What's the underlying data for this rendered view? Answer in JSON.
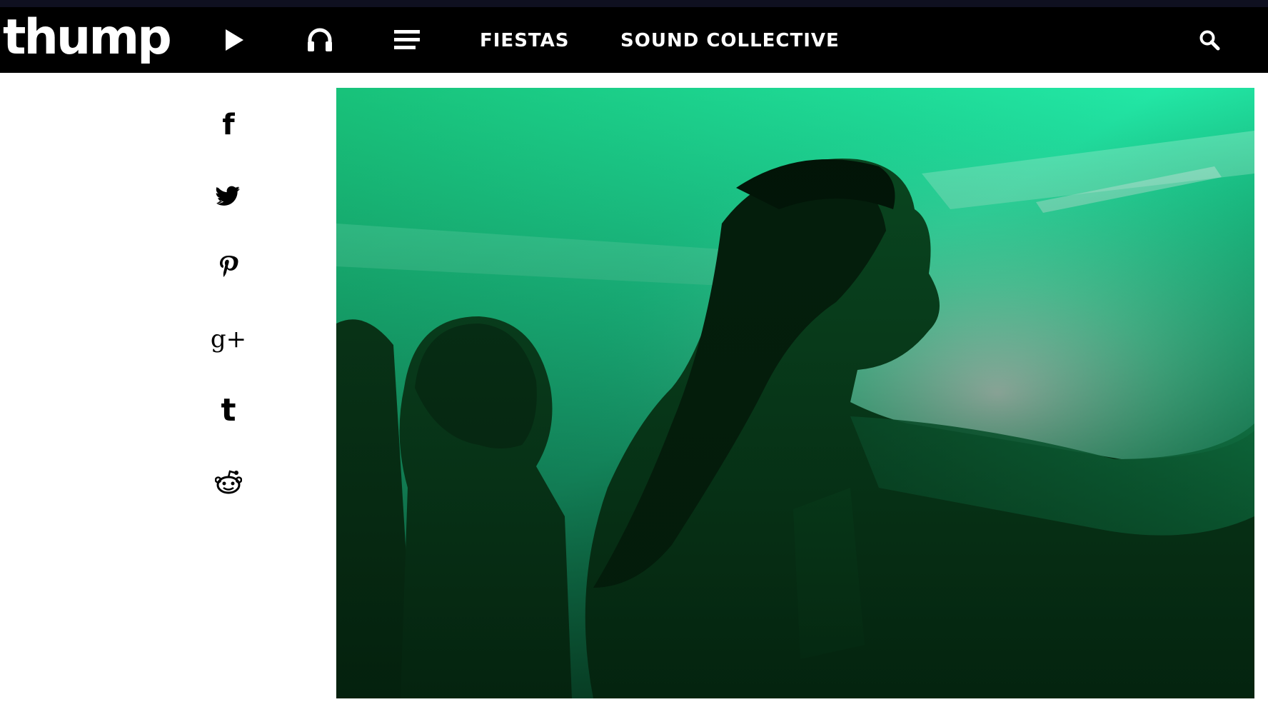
{
  "header": {
    "logo_text": "thump",
    "nav_icons": [
      {
        "icon": "play-icon"
      },
      {
        "icon": "headphones-icon"
      },
      {
        "icon": "menu-icon"
      }
    ],
    "nav_links": [
      {
        "label": "FIESTAS"
      },
      {
        "label": "SOUND COLLECTIVE"
      }
    ],
    "search_icon": "search-icon"
  },
  "share": {
    "buttons": [
      {
        "network": "facebook",
        "icon": "facebook-icon",
        "glyph": "f"
      },
      {
        "network": "twitter",
        "icon": "twitter-icon"
      },
      {
        "network": "pinterest",
        "icon": "pinterest-icon",
        "glyph": "P"
      },
      {
        "network": "google-plus",
        "icon": "google-plus-icon",
        "glyph": "g+"
      },
      {
        "network": "tumblr",
        "icon": "tumblr-icon",
        "glyph": "t"
      },
      {
        "network": "reddit",
        "icon": "reddit-icon"
      }
    ]
  },
  "hero": {
    "accent_color": "#19d98a",
    "dark_color": "#031a0a"
  },
  "colors": {
    "nav_bg": "#000000",
    "top_strip": "#0f1020",
    "page_bg": "#ffffff",
    "nav_text": "#ffffff"
  }
}
